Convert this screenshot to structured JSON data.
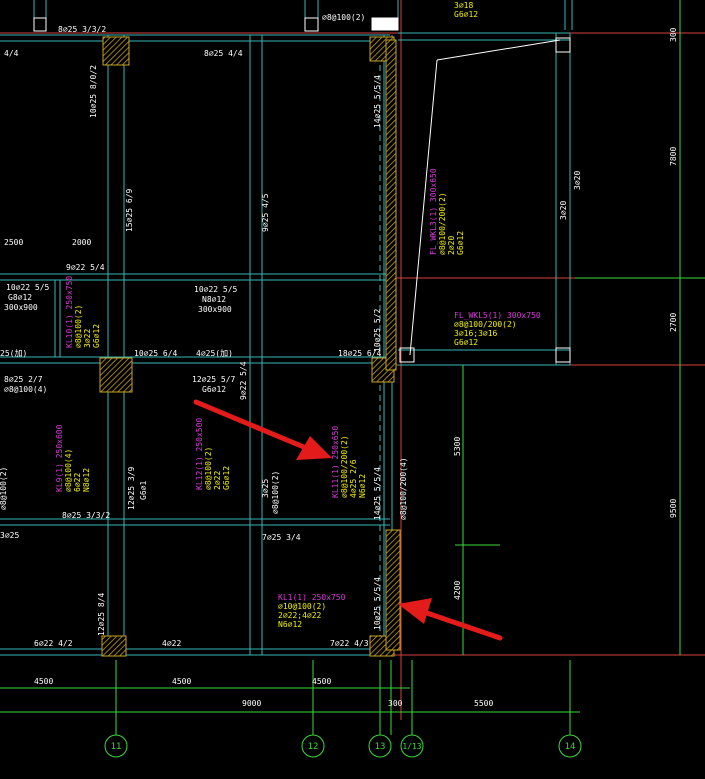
{
  "colors": {
    "background": "#000000",
    "beam": "#39b6b6",
    "column_hatch": "#c9a227",
    "label_white": "#ffffff",
    "label_magenta": "#d83bd8",
    "label_yellow": "#f2f200",
    "grid_axis": "#d84040",
    "dimension": "#3bd83b",
    "arrow": "#e31b1b"
  },
  "rebar_labels": {
    "top_a": "8⌀25 3/3/2",
    "top_b": "⌀8@100(2)",
    "top_c": "8⌀25 4/4",
    "top_d": "4/4",
    "top_e": "3⌀18",
    "top_f": "G6⌀12",
    "v1": "10⌀25 8/0/2",
    "v2": "15⌀25 6/9",
    "v3": "9⌀25 4/5",
    "v4": "14⌀25 5/5/4",
    "v5": "10⌀25 5/2",
    "dim2500": "2500",
    "dim2000": "2000",
    "m1": "9⌀22 5/4",
    "m2": "10⌀22 5/5",
    "m3": "10⌀22 5/5",
    "m4": "N8⌀12",
    "m5": "300x900",
    "m6": "G8⌀12",
    "m7": "300x900",
    "m8": "10⌀25 6/4",
    "m9": "4⌀25(加)",
    "m10": "18⌀25 6/4",
    "m11": "25(加)",
    "m12": "12⌀25 5/7",
    "m13": "G6⌀12",
    "m14": "9⌀22 5/4",
    "m15": "8⌀25 2/7",
    "m16": "⌀8@100(4)",
    "m17": "8⌀25 3/3/2",
    "m18": "12⌀25 3/9",
    "m19": "G6⌀1",
    "m20": "3⌀25",
    "m21": "⌀8@100(2)",
    "m22": "14⌀25 5/5/4",
    "m23": "10⌀25 5/5/4",
    "m24": "⌀8@100/200(4)",
    "m25": "3⌀25",
    "m26": "7⌀25 3/4",
    "m27": "6⌀22 4/2",
    "m28": "4⌀22",
    "m29": "7⌀22 4/3",
    "m30": "12⌀25 8/4",
    "m31": "14⌀25 5/5/4",
    "m32": "10⌀25 8/0/2",
    "r1": "3⌀20",
    "r2": "3⌀20",
    "r3": "3⌀16",
    "r4": "G6⌀12",
    "r5": "⌀8@100/200",
    "r6": "3⌀20",
    "r7": "3⌀20"
  },
  "beam_tags": {
    "kl_a_title": "KL1(1) 250x750",
    "kl_a_l1": "⌀10@100(2)",
    "kl_a_l2": "2⌀22;4⌀22",
    "kl_a_l3": "N6⌀12",
    "fl_r_title": "FL_WKL5(1) 300x750",
    "fl_r_l1": "⌀8@100/200(2)",
    "fl_r_l2": "3⌀16;3⌀16",
    "fl_r_l3": "G6⌀12",
    "v_tag1": "FL_WKL3(1) 300x650",
    "v_tag1a": "⌀8@100/200(2)",
    "v_tag1b": "2⌀20",
    "v_tag1c": "G6⌀12",
    "v_tag2": "KL12(1) 250x500",
    "v_tag2a": "⌀8@100(2)",
    "v_tag2b": "2⌀22",
    "v_tag2c": "G6⌀12",
    "v_tag3": "KL9(1) 250x600",
    "v_tag3a": "⌀8@100(4)",
    "v_tag3b": "6⌀22",
    "v_tag3c": "N8⌀12",
    "v_tag4": "KL10(1) 250x750",
    "v_tag4a": "⌀8@100(2)",
    "v_tag4b": "3⌀22",
    "v_tag4c": "G6⌀12",
    "v_tag5": "KL11(1) 250x650",
    "v_tag5a": "⌀8@100/200(2)",
    "v_tag5b": "4⌀25 2/6",
    "v_tag5c": "N6⌀12",
    "left_edge": "⌀8@100(2)"
  },
  "dimensions": {
    "d4500a": "4500",
    "d4500b": "4500",
    "d4500c": "4500",
    "d9000": "9000",
    "d300": "300",
    "d5500": "5500",
    "d5300": "5300",
    "d4200": "4200",
    "d300r": "300",
    "d7800": "7800",
    "d2700": "2700",
    "d9500": "9500"
  },
  "axis_labels": {
    "a11": "11",
    "a12": "12",
    "a13": "13",
    "a1_13": "1/13",
    "a14": "14"
  },
  "annotation_arrows": [
    {
      "name": "arrow-upper",
      "target": "beam label"
    },
    {
      "name": "arrow-lower",
      "target": "column edge"
    }
  ]
}
